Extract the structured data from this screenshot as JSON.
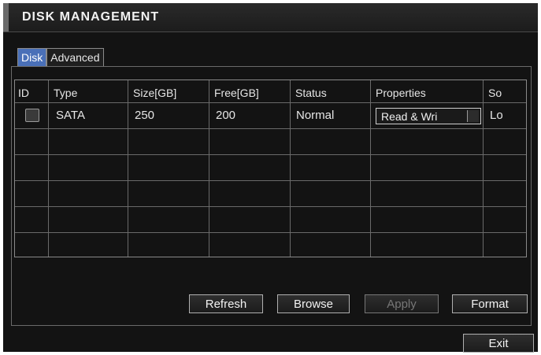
{
  "title": "DISK MANAGEMENT",
  "tabs": [
    {
      "label": "Disk",
      "active": true
    },
    {
      "label": "Advanced",
      "active": false
    }
  ],
  "table": {
    "headers": [
      "ID",
      "Type",
      "Size[GB]",
      "Free[GB]",
      "Status",
      "Properties",
      "So"
    ],
    "rows": [
      {
        "id_checked": false,
        "type": "SATA",
        "size": "250",
        "free": "200",
        "status": "Normal",
        "properties": "Read & Wri",
        "source": "Lo"
      }
    ]
  },
  "buttons": {
    "refresh": "Refresh",
    "browse": "Browse",
    "apply": "Apply",
    "format": "Format",
    "exit": "Exit"
  },
  "colors": {
    "background": "#131313",
    "active_tab": "#4a70b8",
    "text": "#e6e6e6",
    "disabled_text": "#777777"
  }
}
